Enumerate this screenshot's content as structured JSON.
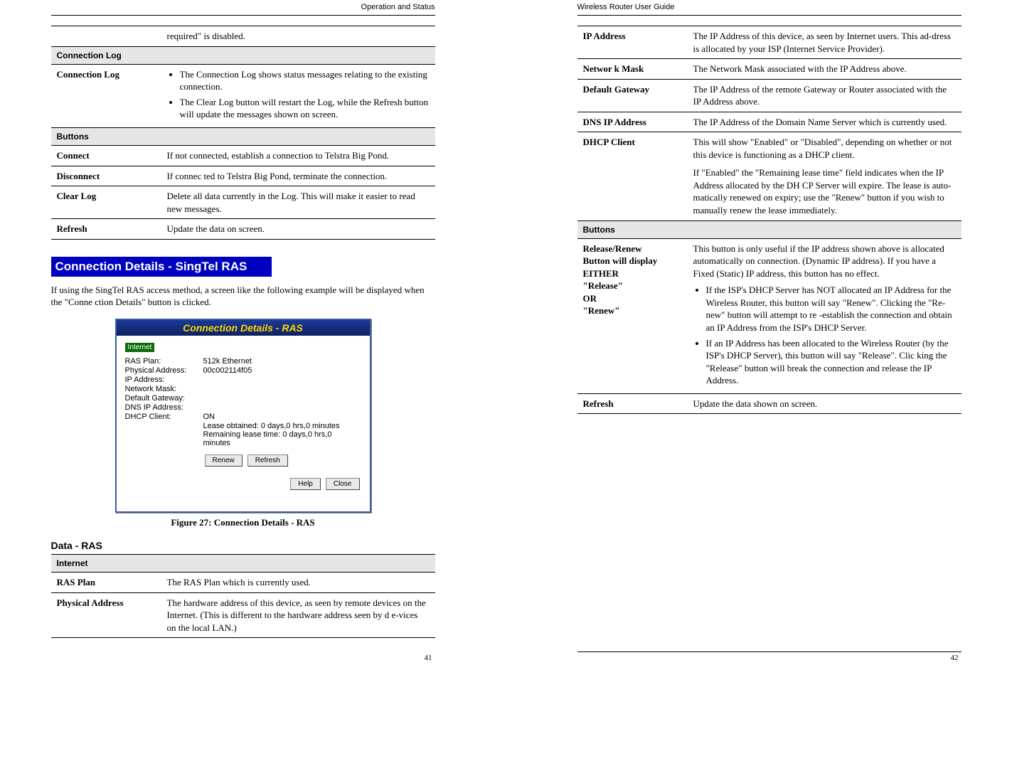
{
  "left": {
    "running_head": "Operation and Status",
    "page_num": "41",
    "top_cell": "required\" is disabled.",
    "sect_connlog": "Connection Log",
    "row_connlog_label": "Connection Log",
    "row_connlog_b1": "The Connection Log shows status messages relating to the existing connection.",
    "row_connlog_b2": "The Clear Log button will restart the Log, while the Refresh button will update the messages shown on screen.",
    "sect_buttons": "Buttons",
    "row_connect_l": "Connect",
    "row_connect_v": "If not connected, establish a connection to Telstra Big Pond.",
    "row_disconnect_l": "Disconnect",
    "row_disconnect_v": "If connec ted to Telstra Big Pond, terminate the connection.",
    "row_clearlog_l": "Clear Log",
    "row_clearlog_v": "Delete all data currently in the Log. This will make it easier to read new messages.",
    "row_refresh_l": "Refresh",
    "row_refresh_v": "Update the data on screen.",
    "blue_heading": "Connection Details - SingTel RAS",
    "intro_para": "If using the SingTel RAS access method, a screen like the following example will be displayed when the \"Conne ction Details\" button is clicked.",
    "figure": {
      "title": "Connection Details - RAS",
      "section": "Internet",
      "rows": {
        "ras_plan_k": "RAS Plan:",
        "ras_plan_v": "512k Ethernet",
        "phys_k": "Physical Address:",
        "phys_v": "00c002114f05",
        "ip_k": "IP Address:",
        "nm_k": "Network Mask:",
        "gw_k": "Default Gateway:",
        "dns_k": "DNS IP Address:",
        "dhcp_k": "DHCP Client:",
        "dhcp_v": "ON",
        "lease_obt": "Lease obtained:        0 days,0 hrs,0 minutes",
        "lease_rem": "Remaining lease time: 0 days,0 hrs,0 minutes"
      },
      "btn_renew": "Renew",
      "btn_refresh": "Refresh",
      "btn_help": "Help",
      "btn_close": "Close",
      "caption": "Figure 27: Connection Details - RAS"
    },
    "data_ras_heading": "Data - RAS",
    "sect_internet": "Internet",
    "row_rasplan_l": "RAS Plan",
    "row_rasplan_v": "The RAS Plan which is currently used.",
    "row_physaddr_l": "Physical Address",
    "row_physaddr_v": "The hardware address of this device, as seen by remote devices on the Internet. (This is different to the hardware address seen by d e-vices on the local LAN.)"
  },
  "right": {
    "running_head": "Wireless Router User Guide",
    "page_num": "42",
    "rows": {
      "ip_l": "IP Address",
      "ip_v": "The IP Address of this device, as seen by Internet users. This ad-dress is allocated by your ISP (Internet Service Provider).",
      "nm_l": "Networ k Mask",
      "nm_v": "The Network Mask associated with the IP Address above.",
      "gw_l": "Default Gateway",
      "gw_v": "The IP Address of the remote Gateway or Router associated with the IP Address above.",
      "dns_l": "DNS IP Address",
      "dns_v": "The IP Address of the Domain Name Server which is currently used.",
      "dhcp_l": "DHCP Client",
      "dhcp_v1": "This will show \"Enabled\" or \"Disabled\", depending on whether or not this device is functioning as a DHCP client.",
      "dhcp_v2": "If \"Enabled\" the \"Remaining lease time\" field indicates when the IP Address allocated by the DH CP Server will expire. The lease is auto-matically renewed on expiry; use the \"Renew\" button if you wish to manually renew the lease immediately.",
      "buttons": "Buttons",
      "rr_l": "Release/Renew\nButton will display\nEITHER\n\"Release\"\nOR\n\"Renew\"",
      "rr_v_intro": "This button is only useful if the IP address shown above is allocated automatically on connection. (Dynamic IP address). If you have a Fixed (Static) IP address, this button has no effect.",
      "rr_b1": "If the ISP's DHCP Server has NOT allocated an IP Address for the Wireless Router, this button will say \"Renew\". Clicking the \"Re-new\" button will attempt to re -establish the connection and obtain an IP Address from the ISP's DHCP Server.",
      "rr_b2": "If an IP Address has been allocated to the Wireless Router (by the ISP's DHCP Server), this button will say \"Release\". Clic king the \"Release\" button will break the connection and release the IP Address.",
      "refresh_l": "Refresh",
      "refresh_v": "Update the data shown on screen."
    }
  }
}
